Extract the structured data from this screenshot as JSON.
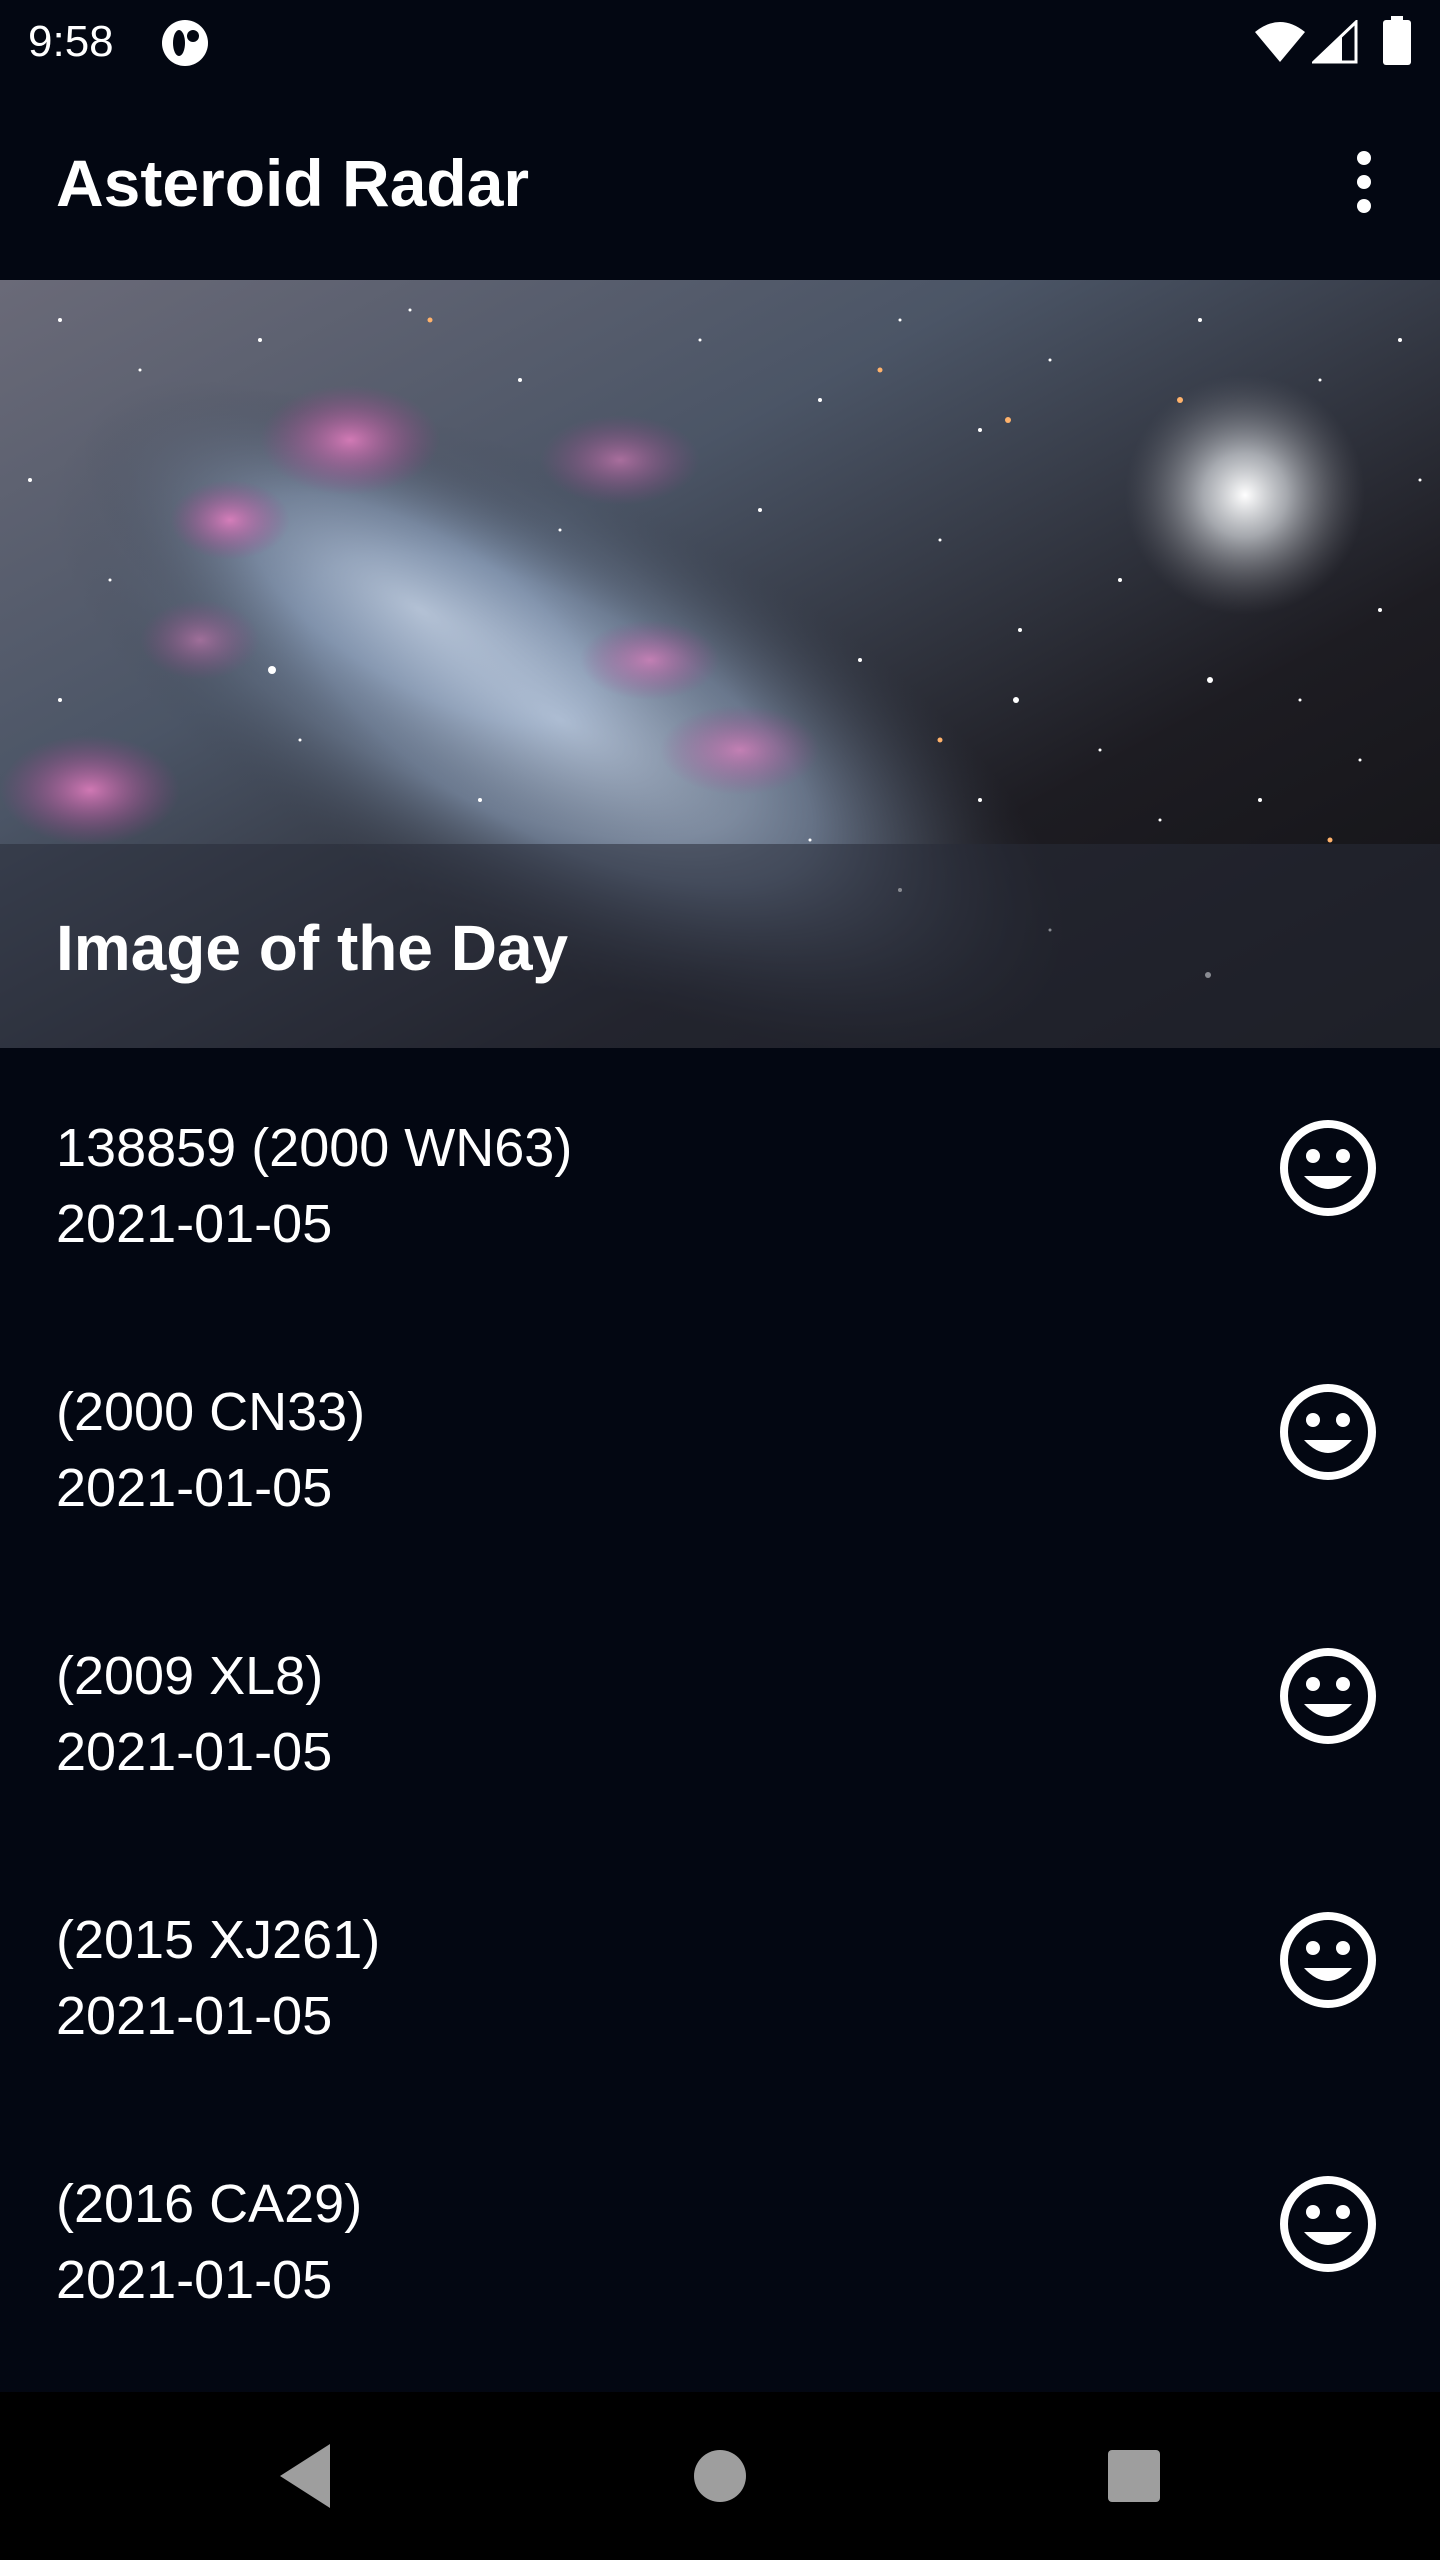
{
  "status_bar": {
    "time": "9:58"
  },
  "app_bar": {
    "title": "Asteroid Radar",
    "overflow_icon": "more-vert-icon"
  },
  "image_of_day": {
    "caption": "Image of the Day"
  },
  "asteroids": [
    {
      "name": "138859 (2000 WN63)",
      "date": "2021-01-05",
      "status_icon": "smiley-icon"
    },
    {
      "name": "(2000 CN33)",
      "date": "2021-01-05",
      "status_icon": "smiley-icon"
    },
    {
      "name": "(2009 XL8)",
      "date": "2021-01-05",
      "status_icon": "smiley-icon"
    },
    {
      "name": "(2015 XJ261)",
      "date": "2021-01-05",
      "status_icon": "smiley-icon"
    },
    {
      "name": "(2016 CA29)",
      "date": "2021-01-05",
      "status_icon": "smiley-icon"
    }
  ],
  "colors": {
    "background": "#030712",
    "text": "#ffffff",
    "nav_bar": "#000000",
    "nav_icons": "#9e9e9e"
  }
}
